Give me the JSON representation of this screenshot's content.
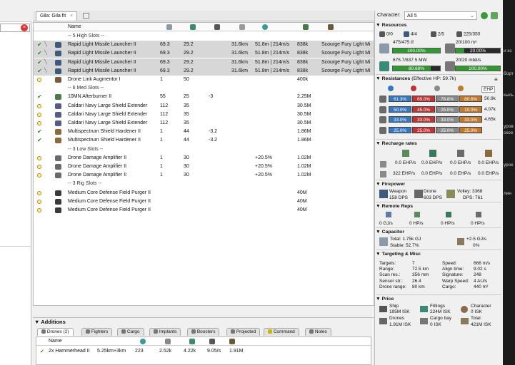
{
  "fit_tab": {
    "label": "Gila: Gila fit",
    "close": "×"
  },
  "module_headers": [
    "Name"
  ],
  "modules": [
    {
      "kind": "sep",
      "label": "-- 5 High Slots --"
    },
    {
      "kind": "mod",
      "state": "active",
      "sel": true,
      "icon_color": "#3d5a7a",
      "name": "Rapid Light Missile Launcher II",
      "c1": "69.3",
      "c2": "29.2",
      "c3": "",
      "c4": "31.6km",
      "c5": "51.8m | 214m/s",
      "c6": "838k",
      "c7": "Scourge Fury Light Mi"
    },
    {
      "kind": "mod",
      "state": "active",
      "sel": true,
      "icon_color": "#3d5a7a",
      "name": "Rapid Light Missile Launcher II",
      "c1": "69.3",
      "c2": "29.2",
      "c3": "",
      "c4": "31.6km",
      "c5": "51.8m | 214m/s",
      "c6": "838k",
      "c7": "Scourge Fury Light Mi"
    },
    {
      "kind": "mod",
      "state": "active",
      "sel": true,
      "icon_color": "#3d5a7a",
      "name": "Rapid Light Missile Launcher II",
      "c1": "69.3",
      "c2": "29.2",
      "c3": "",
      "c4": "31.6km",
      "c5": "51.8m | 214m/s",
      "c6": "838k",
      "c7": "Scourge Fury Light Mi"
    },
    {
      "kind": "mod",
      "state": "active",
      "sel": true,
      "icon_color": "#3d5a7a",
      "name": "Rapid Light Missile Launcher II",
      "c1": "69.3",
      "c2": "29.2",
      "c3": "",
      "c4": "31.6km",
      "c5": "51.8m | 214m/s",
      "c6": "838k",
      "c7": "Scourge Fury Light Mi"
    },
    {
      "kind": "mod",
      "state": "offline",
      "sel": false,
      "icon_color": "#7a5a3d",
      "name": "Drone Link Augmentor I",
      "c1": "1",
      "c2": "50",
      "c3": "",
      "c4": "",
      "c5": "",
      "c6": "400k",
      "c7": ""
    },
    {
      "kind": "sep",
      "label": "-- 6 Med Slots --"
    },
    {
      "kind": "mod",
      "state": "online",
      "sel": false,
      "icon_color": "#4a7a4a",
      "name": "10MN Afterburner II",
      "c1": "55",
      "c2": "25",
      "c3": "-3",
      "c4": "",
      "c5": "",
      "c6": "2.25M",
      "c7": ""
    },
    {
      "kind": "mod",
      "state": "offline",
      "sel": false,
      "icon_color": "#5a5a8a",
      "name": "Caldari Navy Large Shield Extender",
      "c1": "112",
      "c2": "35",
      "c3": "",
      "c4": "",
      "c5": "",
      "c6": "30.5M",
      "c7": ""
    },
    {
      "kind": "mod",
      "state": "offline",
      "sel": false,
      "icon_color": "#5a5a8a",
      "name": "Caldari Navy Large Shield Extender",
      "c1": "112",
      "c2": "35",
      "c3": "",
      "c4": "",
      "c5": "",
      "c6": "30.5M",
      "c7": ""
    },
    {
      "kind": "mod",
      "state": "offline",
      "sel": false,
      "icon_color": "#5a5a8a",
      "name": "Caldari Navy Large Shield Extender",
      "c1": "112",
      "c2": "35",
      "c3": "",
      "c4": "",
      "c5": "",
      "c6": "30.5M",
      "c7": ""
    },
    {
      "kind": "mod",
      "state": "overload",
      "sel": false,
      "icon_color": "#8a6a3a",
      "name": "Multispectrum Shield Hardener II",
      "c1": "1",
      "c2": "44",
      "c3": "-3.2",
      "c4": "",
      "c5": "",
      "c6": "1.86M",
      "c7": ""
    },
    {
      "kind": "mod",
      "state": "overload",
      "sel": false,
      "icon_color": "#8a6a3a",
      "name": "Multispectrum Shield Hardener II",
      "c1": "1",
      "c2": "44",
      "c3": "-3.2",
      "c4": "",
      "c5": "",
      "c6": "1.86M",
      "c7": ""
    },
    {
      "kind": "sep",
      "label": "-- 3 Low Slots --"
    },
    {
      "kind": "mod",
      "state": "offline",
      "sel": false,
      "icon_color": "#6a6a6a",
      "name": "Drone Damage Amplifier II",
      "c1": "1",
      "c2": "30",
      "c3": "",
      "c4": "",
      "c5": "+20.5%",
      "c6": "1.02M",
      "c7": ""
    },
    {
      "kind": "mod",
      "state": "offline",
      "sel": false,
      "icon_color": "#6a6a6a",
      "name": "Drone Damage Amplifier II",
      "c1": "1",
      "c2": "30",
      "c3": "",
      "c4": "",
      "c5": "+20.5%",
      "c6": "1.02M",
      "c7": ""
    },
    {
      "kind": "mod",
      "state": "offline",
      "sel": false,
      "icon_color": "#6a6a6a",
      "name": "Drone Damage Amplifier II",
      "c1": "1",
      "c2": "30",
      "c3": "",
      "c4": "",
      "c5": "+20.5%",
      "c6": "1.02M",
      "c7": ""
    },
    {
      "kind": "sep",
      "label": "-- 3 Rig Slots --"
    },
    {
      "kind": "mod",
      "state": "offline",
      "sel": false,
      "icon_color": "#3a3a3a",
      "name": "Medium Core Defense Field Purger II",
      "c1": "",
      "c2": "",
      "c3": "",
      "c4": "",
      "c5": "",
      "c6": "40M",
      "c7": ""
    },
    {
      "kind": "mod",
      "state": "offline",
      "sel": false,
      "icon_color": "#3a3a3a",
      "name": "Medium Core Defense Field Purger II",
      "c1": "",
      "c2": "",
      "c3": "",
      "c4": "",
      "c5": "",
      "c6": "40M",
      "c7": ""
    },
    {
      "kind": "mod",
      "state": "offline",
      "sel": false,
      "icon_color": "#3a3a3a",
      "name": "Medium Core Defense Field Purger II",
      "c1": "",
      "c2": "",
      "c3": "",
      "c4": "",
      "c5": "",
      "c6": "40M",
      "c7": ""
    }
  ],
  "additions": {
    "title": "Additions",
    "tabs": [
      "Drones (2)",
      "Fighters",
      "Cargo",
      "Implants",
      "Boosters",
      "Projected",
      "Command",
      "Notes"
    ],
    "drone_header": "Name",
    "drone_row": {
      "name": "2x Hammerhead II",
      "range": "5.25km+3km",
      "c1": "223",
      "c2": "2.52k",
      "c3": "4.22k",
      "c4": "9.05/s",
      "c5": "1.91M"
    }
  },
  "character": {
    "label": "Character:",
    "value": "All 5"
  },
  "resources": {
    "title": "Resources",
    "turrets": "0/0",
    "launchers": "4/4",
    "calibration": "2/5",
    "calibration_total": "225/350",
    "cpu_text": "475/475 tf",
    "cpu_bar": "100.00%",
    "cpu_fraction": 1.0,
    "drone_bay_text": "20/100 m³",
    "drone_bay_bar": "20.00%",
    "drone_bay_fraction": 0.2,
    "pg_text": "675.7/837.5 MW",
    "pg_bar": "80.68%",
    "pg_fraction": 0.8068,
    "bandwidth_text": "20/20 mbit/s",
    "bandwidth_bar": "100.00%",
    "bandwidth_fraction": 1.0
  },
  "resistances": {
    "title": "Resistances",
    "ehp_note": "(Effective HP: 59.7k)",
    "ehp_label": "EHP",
    "rows": [
      {
        "layer": "shield",
        "values": [
          "61.3%",
          "69.0%",
          "78.8%",
          "80.6%"
        ],
        "ehp": "50.9k"
      },
      {
        "layer": "armor",
        "values": [
          "50.0%",
          "45.0%",
          "25.0%",
          "10.0%"
        ],
        "ehp": "4.07k"
      },
      {
        "layer": "hull",
        "values": [
          "33.0%",
          "33.0%",
          "33.0%",
          "33.0%"
        ],
        "ehp": "4.65k"
      },
      {
        "layer": "avg",
        "values": [
          "25.0%",
          "25.0%",
          "25.0%",
          "25.0%"
        ],
        "ehp": ""
      }
    ],
    "colors": [
      "#3477c2",
      "#c23434",
      "#8a8a8a",
      "#c27a2a"
    ]
  },
  "recharge": {
    "title": "Recharge rates",
    "row1": [
      "0.0 EHP/s",
      "0.0 EHP/s",
      "0.0 EHP/s"
    ],
    "row2": [
      "322 EHP/s",
      "0.0 EHP/s",
      "0.0 EHP/s",
      "0.0 EHP/s"
    ]
  },
  "firepower": {
    "title": "Firepower",
    "weapon_label": "Weapon",
    "weapon_dps": "158 DPS",
    "drone_label": "Drone",
    "drone_dps": "603 DPS",
    "volley": "Volley: 3368",
    "dps": "DPS: 761"
  },
  "remote_reps": {
    "title": "Remote Reps",
    "values": [
      "0 GJ/s",
      "0 HP/s",
      "0 HP/s",
      "0 HP/s"
    ]
  },
  "capacitor": {
    "title": "Capacitor",
    "total": "Total: 1.75k GJ",
    "stable": "Stable: 52.7%",
    "delta": "+2.5 GJ/s",
    "delta_pct": "0%"
  },
  "targeting": {
    "title": "Targeting & Misc",
    "left_labels": [
      "Targets:",
      "Range:",
      "Scan res.:",
      "Sensor str.:",
      "Drone range:"
    ],
    "left_values": [
      "7",
      "72.5 km",
      "356 mm",
      "26.4",
      "80 km"
    ],
    "right_labels": [
      "Speed:",
      "Align time:",
      "Signature:",
      "Warp Speed:",
      "Cargo:"
    ],
    "right_values": [
      "666 m/s",
      "9.02 s",
      "248",
      "4 AU/s",
      "440 m³"
    ]
  },
  "price": {
    "title": "Price",
    "ship_label": "Ship",
    "ship_value": "195M ISK",
    "fittings_label": "Fittings",
    "fittings_value": "224M ISK",
    "character_label": "Character",
    "character_value": "0 ISK",
    "drones_label": "Drones",
    "drones_value": "1.91M ISK",
    "cargo_label": "Cargo bay",
    "cargo_value": "0 ISK",
    "total_label": "Total",
    "total_value": "421M ISK"
  },
  "dark_strip_text": [
    "и кс",
    "борт",
    "кысь",
    "уров",
    "ское",
    "урок",
    "лин"
  ],
  "colors": {
    "bar_green": "#2f9a2f",
    "bar_dark": "#2a2a2a",
    "accent": "#2a8a2a"
  }
}
